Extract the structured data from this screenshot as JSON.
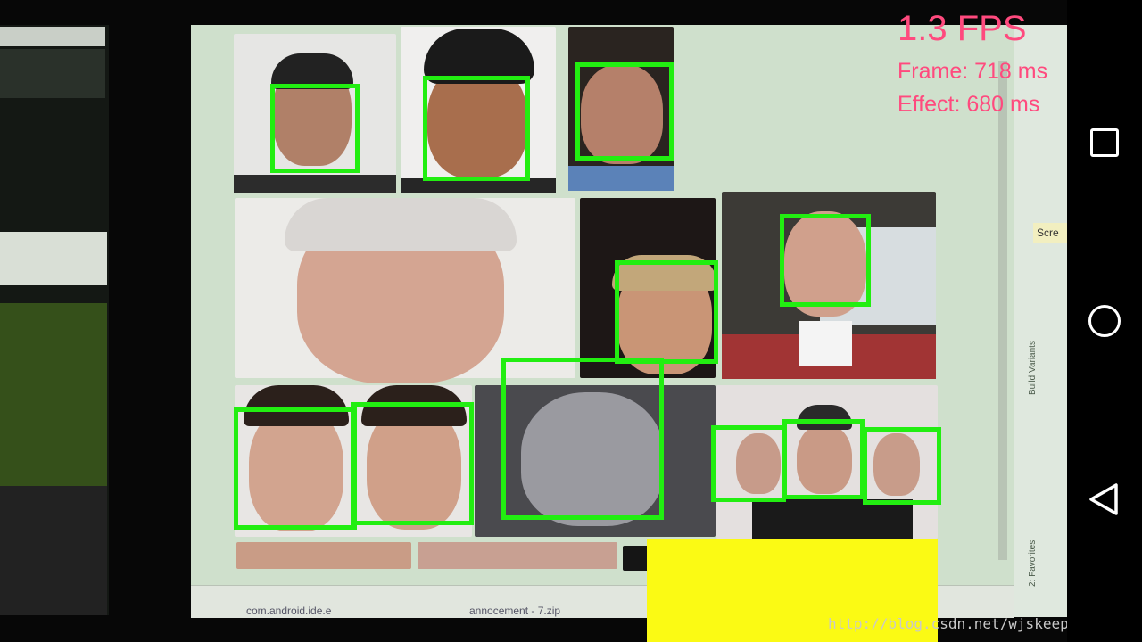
{
  "overlay": {
    "fps": "1.3 FPS",
    "frame_time": "Frame: 718 ms",
    "effect_time": "Effect:  680 ms"
  },
  "watermark": "http://blog.csdn.net/wjskeepmaking",
  "ide": {
    "tooltip": "Scre",
    "side_panel_1": "Build Variants",
    "side_panel_2": "2: Favorites",
    "taskbar_item_1": "com.android.ide.e",
    "taskbar_item_2": "annocement - 7.zip"
  },
  "navbar": {
    "recent_icon": "square-recent-apps-icon",
    "home_icon": "circle-home-icon",
    "back_icon": "triangle-back-icon"
  },
  "colors": {
    "detection_box": "#22ee11",
    "overlay_text": "#ff4a7e",
    "occluder": "#fbfa14"
  }
}
